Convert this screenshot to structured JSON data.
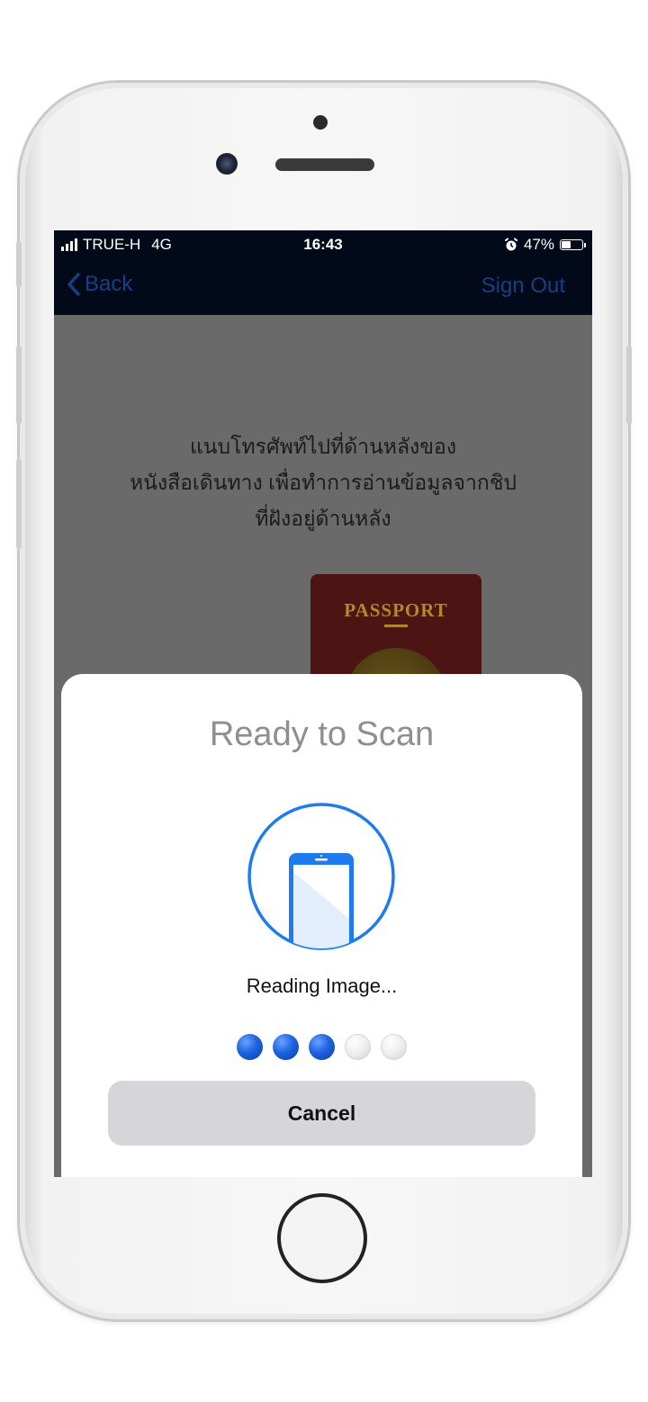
{
  "status_bar": {
    "carrier": "TRUE-H",
    "network": "4G",
    "time": "16:43",
    "battery": "47%",
    "battery_level": 0.47,
    "icons": [
      "signal-bars-icon",
      "alarm-icon",
      "battery-icon"
    ]
  },
  "nav": {
    "back_label": "Back",
    "signout_label": "Sign Out",
    "back_icon": "chevron-left-icon"
  },
  "instruction": {
    "line1": "แนบโทรศัพท์ไปที่ด้านหลังของ",
    "line2": "หนังสือเดินทาง เพื่อทำการอ่านข้อมูลจากชิป",
    "line3": "ที่ฝังอยู่ด้านหลัง"
  },
  "passport": {
    "title": "PASSPORT"
  },
  "scan_sheet": {
    "title": "Ready to Scan",
    "status": "Reading Image...",
    "progress_steps_total": 5,
    "progress_steps_done": 3,
    "cancel_label": "Cancel",
    "icon": "phone-scan-icon"
  },
  "colors": {
    "accent_blue": "#1d7bed",
    "nav_bg": "#020a19",
    "nav_text": "#173f86",
    "overlay": "#6a6a6a",
    "passport_red": "#4d1414",
    "passport_gold": "#b3872a"
  }
}
